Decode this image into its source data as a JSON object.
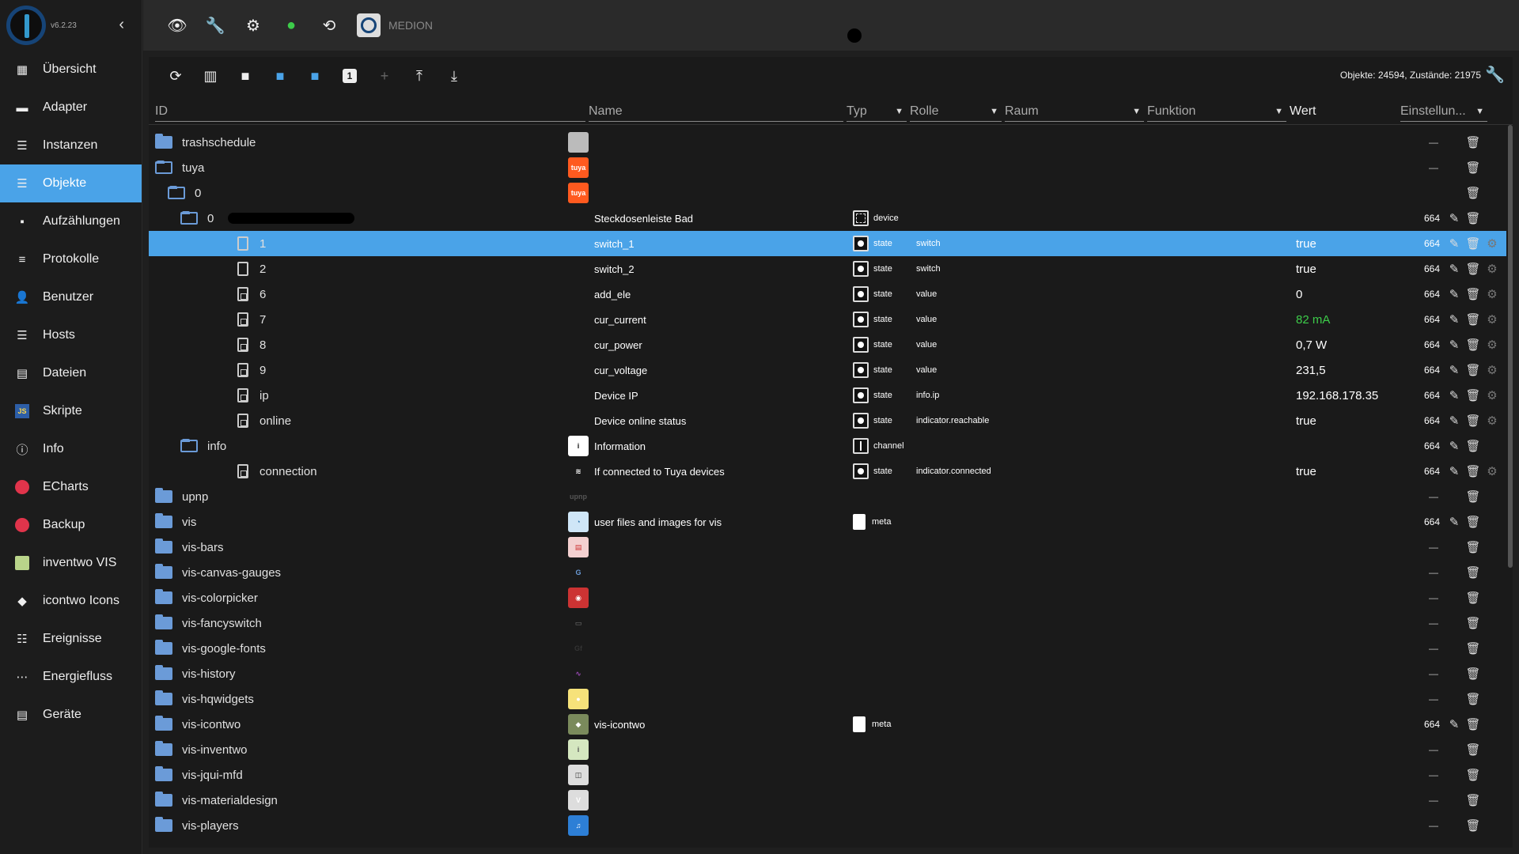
{
  "app": {
    "version": "v6.2.23",
    "host_name": "MEDION"
  },
  "sidebar": {
    "items": [
      {
        "label": "Übersicht",
        "icon": "grid-icon",
        "active": false
      },
      {
        "label": "Adapter",
        "icon": "store-icon",
        "active": false
      },
      {
        "label": "Instanzen",
        "icon": "instances-icon",
        "active": false
      },
      {
        "label": "Objekte",
        "icon": "list-icon",
        "active": true
      },
      {
        "label": "Aufzählungen",
        "icon": "enum-icon",
        "active": false
      },
      {
        "label": "Protokolle",
        "icon": "log-icon",
        "active": false
      },
      {
        "label": "Benutzer",
        "icon": "user-icon",
        "active": false
      },
      {
        "label": "Hosts",
        "icon": "hosts-icon",
        "active": false
      },
      {
        "label": "Dateien",
        "icon": "files-icon",
        "active": false
      },
      {
        "label": "Skripte",
        "icon": "js-icon",
        "active": false
      },
      {
        "label": "Info",
        "icon": "info-icon",
        "active": false
      },
      {
        "label": "ECharts",
        "icon": "echarts-icon",
        "active": false
      },
      {
        "label": "Backup",
        "icon": "backup-icon",
        "active": false
      },
      {
        "label": "inventwo VIS",
        "icon": "inventwo-icon",
        "active": false
      },
      {
        "label": "icontwo Icons",
        "icon": "icontwo-icon",
        "active": false
      },
      {
        "label": "Ereignisse",
        "icon": "events-icon",
        "active": false
      },
      {
        "label": "Energiefluss",
        "icon": "energy-icon",
        "active": false
      },
      {
        "label": "Geräte",
        "icon": "devices-icon",
        "active": false
      }
    ]
  },
  "toolbar": {
    "counts": "Objekte: 24594, Zustände: 21975"
  },
  "columns": {
    "id": "ID",
    "name": "Name",
    "typ": "Typ",
    "rolle": "Rolle",
    "raum": "Raum",
    "funktion": "Funktion",
    "wert": "Wert",
    "einstellungen": "Einstellun..."
  },
  "rows": [
    {
      "id": "trashschedule",
      "indent": 0,
      "kind": "folder",
      "acl": "",
      "dash": "—",
      "img": "trash"
    },
    {
      "id": "tuya",
      "indent": 0,
      "kind": "folder-open",
      "acl": "",
      "dash": "—",
      "img": "tuya"
    },
    {
      "id": "0",
      "indent": 1,
      "kind": "folder-open",
      "acl": "",
      "dash": "",
      "img": "tuya"
    },
    {
      "id": "0",
      "indent": 2,
      "kind": "folder-open",
      "redact": true,
      "name": "Steckdosenleiste Bad",
      "typ": "device",
      "typ_icon": "device",
      "acl": "664",
      "edit": true
    },
    {
      "id": "1",
      "indent": 3,
      "kind": "file",
      "name": "switch_1",
      "typ": "state",
      "role": "switch",
      "value": "true",
      "acl": "664",
      "edit": true,
      "gear": true,
      "selected": true
    },
    {
      "id": "2",
      "indent": 3,
      "kind": "file",
      "name": "switch_2",
      "typ": "state",
      "role": "switch",
      "value": "true",
      "acl": "664",
      "edit": true,
      "gear": true
    },
    {
      "id": "6",
      "indent": 3,
      "kind": "file-val",
      "name": "add_ele",
      "typ": "state",
      "role": "value",
      "value": "0",
      "acl": "664",
      "edit": true,
      "gear": true
    },
    {
      "id": "7",
      "indent": 3,
      "kind": "file-val",
      "name": "cur_current",
      "typ": "state",
      "role": "value",
      "value": "82 mA",
      "value_green": true,
      "acl": "664",
      "edit": true,
      "gear": true
    },
    {
      "id": "8",
      "indent": 3,
      "kind": "file-val",
      "name": "cur_power",
      "typ": "state",
      "role": "value",
      "value": "0,7 W",
      "acl": "664",
      "edit": true,
      "gear": true
    },
    {
      "id": "9",
      "indent": 3,
      "kind": "file-val",
      "name": "cur_voltage",
      "typ": "state",
      "role": "value",
      "value": "231,5",
      "acl": "664",
      "edit": true,
      "gear": true
    },
    {
      "id": "ip",
      "indent": 3,
      "kind": "file-val",
      "name": "Device IP",
      "typ": "state",
      "role": "info.ip",
      "value": "192.168.178.35",
      "acl": "664",
      "edit": true,
      "gear": true
    },
    {
      "id": "online",
      "indent": 3,
      "kind": "file-val",
      "name": "Device online status",
      "typ": "state",
      "role": "indicator.reachable",
      "value": "true",
      "acl": "664",
      "edit": true,
      "gear": true
    },
    {
      "id": "info",
      "indent": 2,
      "kind": "folder-open",
      "name": "Information",
      "typ": "channel",
      "typ_icon": "channel",
      "acl": "664",
      "edit": true,
      "img": "info"
    },
    {
      "id": "connection",
      "indent": 3,
      "kind": "file-val",
      "name": "If connected to Tuya devices",
      "typ": "state",
      "role": "indicator.connected",
      "value": "true",
      "acl": "664",
      "edit": true,
      "gear": true,
      "img": "wifi"
    },
    {
      "id": "upnp",
      "indent": 0,
      "kind": "folder",
      "dash": "—",
      "img": "upnp"
    },
    {
      "id": "vis",
      "indent": 0,
      "kind": "folder",
      "name": "user files and images for vis",
      "typ": "meta",
      "typ_icon": "meta",
      "acl": "664",
      "edit": true,
      "img": "vis"
    },
    {
      "id": "vis-bars",
      "indent": 0,
      "kind": "folder",
      "dash": "—",
      "img": "bars"
    },
    {
      "id": "vis-canvas-gauges",
      "indent": 0,
      "kind": "folder",
      "dash": "—",
      "img": "gauge"
    },
    {
      "id": "vis-colorpicker",
      "indent": 0,
      "kind": "folder",
      "dash": "—",
      "img": "color"
    },
    {
      "id": "vis-fancyswitch",
      "indent": 0,
      "kind": "folder",
      "dash": "—",
      "img": "fancy"
    },
    {
      "id": "vis-google-fonts",
      "indent": 0,
      "kind": "folder",
      "dash": "—",
      "img": "fonts"
    },
    {
      "id": "vis-history",
      "indent": 0,
      "kind": "folder",
      "dash": "—",
      "img": "history"
    },
    {
      "id": "vis-hqwidgets",
      "indent": 0,
      "kind": "folder",
      "dash": "—",
      "img": "hq"
    },
    {
      "id": "vis-icontwo",
      "indent": 0,
      "kind": "folder",
      "name": "vis-icontwo",
      "typ": "meta",
      "typ_icon": "meta",
      "acl": "664",
      "edit": true,
      "img": "icontwo"
    },
    {
      "id": "vis-inventwo",
      "indent": 0,
      "kind": "folder",
      "dash": "—",
      "img": "inventwo"
    },
    {
      "id": "vis-jqui-mfd",
      "indent": 0,
      "kind": "folder",
      "dash": "—",
      "img": "jqui"
    },
    {
      "id": "vis-materialdesign",
      "indent": 0,
      "kind": "folder",
      "dash": "—",
      "img": "material"
    },
    {
      "id": "vis-players",
      "indent": 0,
      "kind": "folder",
      "dash": "—",
      "img": "players"
    }
  ]
}
